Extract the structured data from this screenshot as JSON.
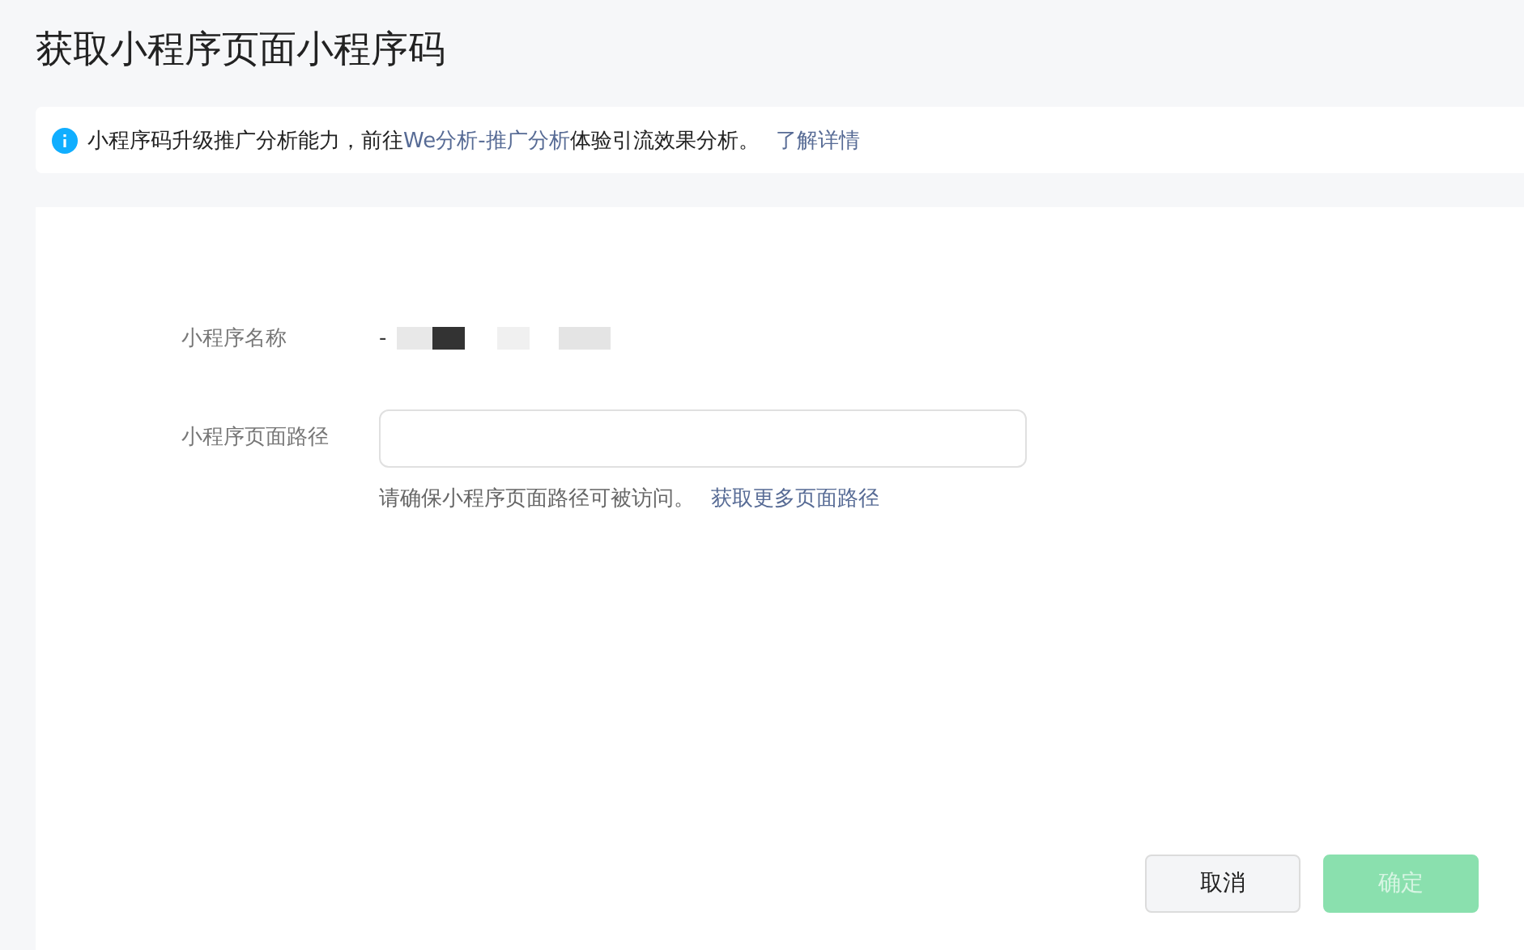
{
  "page_title": "获取小程序页面小程序码",
  "notice": {
    "text_before": "小程序码升级推广分析能力，前往",
    "link": "We分析-推广分析",
    "text_after": "体验引流效果分析。",
    "more_link": "了解详情"
  },
  "form": {
    "name_label": "小程序名称",
    "name_value": "-",
    "path_label": "小程序页面路径",
    "hint": "请确保小程序页面路径可被访问。",
    "hint_link": "获取更多页面路径"
  },
  "buttons": [
    {
      "label": "取消",
      "kind": "secondary",
      "disabled": false
    },
    {
      "label": "确定",
      "kind": "primary",
      "disabled": true
    }
  ]
}
